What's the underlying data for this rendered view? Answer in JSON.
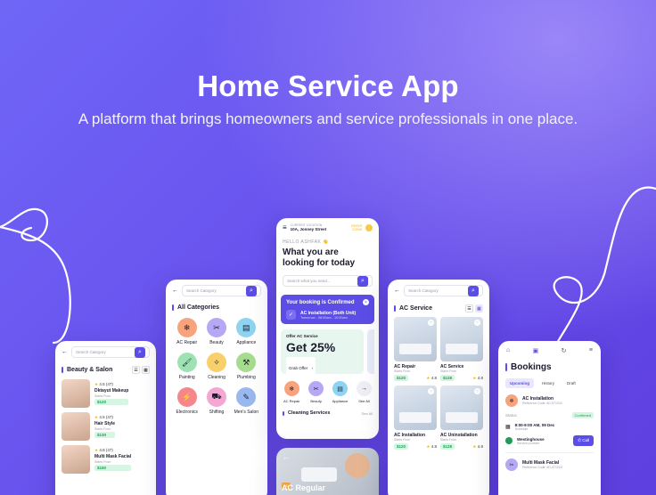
{
  "hero": {
    "title": "Home Service App",
    "subtitle": "A platform that brings homeowners and service professionals in one place."
  },
  "colors": {
    "accent": "#5b4de6",
    "price_bg": "#d7f5e3",
    "price_text": "#1f9d55"
  },
  "screen1": {
    "search_placeholder": "Search Category",
    "section": "Beauty & Salon",
    "items": [
      {
        "rating": "4.5 (47)",
        "name": "Dktayut Makeup",
        "sub": "Starts From",
        "price": "$120"
      },
      {
        "rating": "4.5 (47)",
        "name": "Hair Style",
        "sub": "Starts From",
        "price": "$130"
      },
      {
        "rating": "4.8 (47)",
        "name": "Multi Mask Facial",
        "sub": "Starts From",
        "price": "$150"
      }
    ]
  },
  "screen2": {
    "search_placeholder": "Search Category",
    "section": "All Categories",
    "categories": [
      {
        "label": "AC Repair",
        "icon": "ac-icon",
        "color": "#f7a37d"
      },
      {
        "label": "Beauty",
        "icon": "beauty-icon",
        "color": "#b7a8f5"
      },
      {
        "label": "Appliance",
        "icon": "appliance-icon",
        "color": "#8fd3f2"
      },
      {
        "label": "Painting",
        "icon": "paint-roller-icon",
        "color": "#9ee2b3"
      },
      {
        "label": "Cleaning",
        "icon": "cleaning-icon",
        "color": "#f7cf6b"
      },
      {
        "label": "Plumbing",
        "icon": "plumbing-icon",
        "color": "#a6dc8e"
      },
      {
        "label": "Electronics",
        "icon": "electronics-icon",
        "color": "#f5868b"
      },
      {
        "label": "Shifting",
        "icon": "shifting-icon",
        "color": "#f5a6d3"
      },
      {
        "label": "Men's Salon",
        "icon": "razor-icon",
        "color": "#9ab8f0"
      }
    ]
  },
  "screen3": {
    "location_label": "CURRENT LOCATION",
    "location_value": "10A, Jonney Street",
    "points_label": "REFER",
    "points_value": "COINS",
    "greeting": "HELLO ASHFAK 👋",
    "headline": "What you are looking for today",
    "search_placeholder": "Search what you need...",
    "booking_title": "Your booking is Confirmed",
    "booking_item": "AC Installation (Both Unit)",
    "booking_time": "Tomorrow , 08:00am - 10:00am",
    "offer_label": "Offer AC Service",
    "offer_value": "Get 25%",
    "offer_cta": "Grab Offer",
    "categories": [
      {
        "label": "AC Repair",
        "icon": "ac-icon",
        "color": "#f7a37d"
      },
      {
        "label": "Beauty",
        "icon": "beauty-icon",
        "color": "#b7a8f5"
      },
      {
        "label": "Appliance",
        "icon": "appliance-icon",
        "color": "#8fd3f2"
      },
      {
        "label": "See All",
        "icon": "arrow-right-icon",
        "color": "#eeeef4"
      }
    ],
    "section": "Cleaning Services",
    "see_all": "See All"
  },
  "screen4": {
    "promo_badge": "AC",
    "promo_title": "AC Regular"
  },
  "screen5": {
    "search_placeholder": "Search Category",
    "section": "AC Service",
    "items": [
      {
        "name": "AC Repair",
        "sub": "Starts From",
        "price": "$120",
        "rating": "4.8"
      },
      {
        "name": "AC Service",
        "sub": "Starts From",
        "price": "$128",
        "rating": "4.8"
      },
      {
        "name": "AC Installation",
        "sub": "Starts From",
        "price": "$120",
        "rating": "4.8"
      },
      {
        "name": "AC Uninstallation",
        "sub": "Starts From",
        "price": "$128",
        "rating": "4.8"
      }
    ]
  },
  "screen6": {
    "title": "Bookings",
    "tabs": [
      "Upcoming",
      "History",
      "Draft"
    ],
    "booking1_title": "AC Installation",
    "booking1_ref": "Reference Code: #D-571224",
    "status_label": "Status",
    "status_value": "Confirmed",
    "schedule_time": "8:00-9:00 AM, 09 Dec",
    "schedule_label": "Schedule",
    "provider_name": "Westinghouse",
    "provider_label": "Service provider",
    "call_label": "Call",
    "booking2_title": "Multi Mask Facial",
    "booking2_ref": "Reference Code: #D-571224"
  }
}
